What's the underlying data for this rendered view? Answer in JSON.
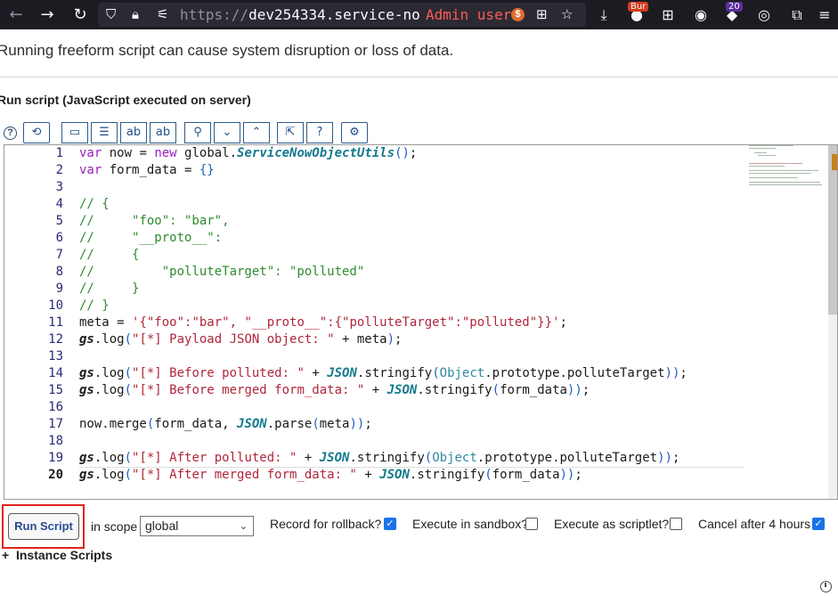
{
  "browser": {
    "url_prefix": "https://",
    "url_host": "dev254334.service-no",
    "admin_label": "Admin user",
    "badges": {
      "bur": "Bur",
      "count": "20"
    }
  },
  "page": {
    "warning": "Running freeform script can cause system disruption or loss of data.",
    "section_title": "Run script (JavaScript executed on server)"
  },
  "editor": {
    "line_numbers": [
      "1",
      "2",
      "3",
      "4",
      "5",
      "6",
      "7",
      "8",
      "9",
      "10",
      "11",
      "12",
      "13",
      "14",
      "15",
      "16",
      "17",
      "18",
      "19",
      "20"
    ]
  },
  "footer": {
    "run_button": "Run Script",
    "scope_label": "in scope",
    "scope_value": "global",
    "rollback_label": "Record for rollback?",
    "sandbox_label": "Execute in sandbox?",
    "scriptlet_label": "Execute as scriptlet?",
    "cancel_label": "Cancel after 4 hours",
    "rollback_checked": true,
    "sandbox_checked": false,
    "scriptlet_checked": false,
    "cancel_checked": true,
    "instance_scripts": "Instance Scripts",
    "instance_prefix": "+"
  }
}
